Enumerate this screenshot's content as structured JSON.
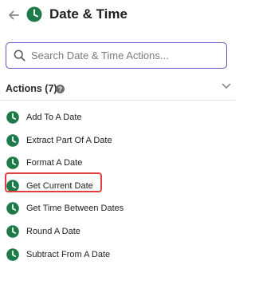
{
  "header": {
    "back_icon": "arrow-left-icon",
    "app_icon": "clock-icon",
    "title": "Date & Time"
  },
  "search": {
    "placeholder": "Search Date & Time Actions...",
    "value": "",
    "icon": "search-icon"
  },
  "actions": {
    "title": "Actions (7)",
    "help_icon": "question-circle-icon",
    "collapse_icon": "chevron-down-icon",
    "items": [
      {
        "label": "Add To A Date",
        "icon": "clock-icon"
      },
      {
        "label": "Extract Part Of A Date",
        "icon": "clock-icon"
      },
      {
        "label": "Format A Date",
        "icon": "clock-icon"
      },
      {
        "label": "Get Current Date",
        "icon": "clock-icon",
        "highlighted": true
      },
      {
        "label": "Get Time Between Dates",
        "icon": "clock-icon"
      },
      {
        "label": "Round A Date",
        "icon": "clock-icon"
      },
      {
        "label": "Subtract From A Date",
        "icon": "clock-icon"
      }
    ]
  },
  "colors": {
    "clock_green": "#1f7a4a",
    "search_border": "#5a55c9",
    "highlight_red": "#e0413f"
  }
}
